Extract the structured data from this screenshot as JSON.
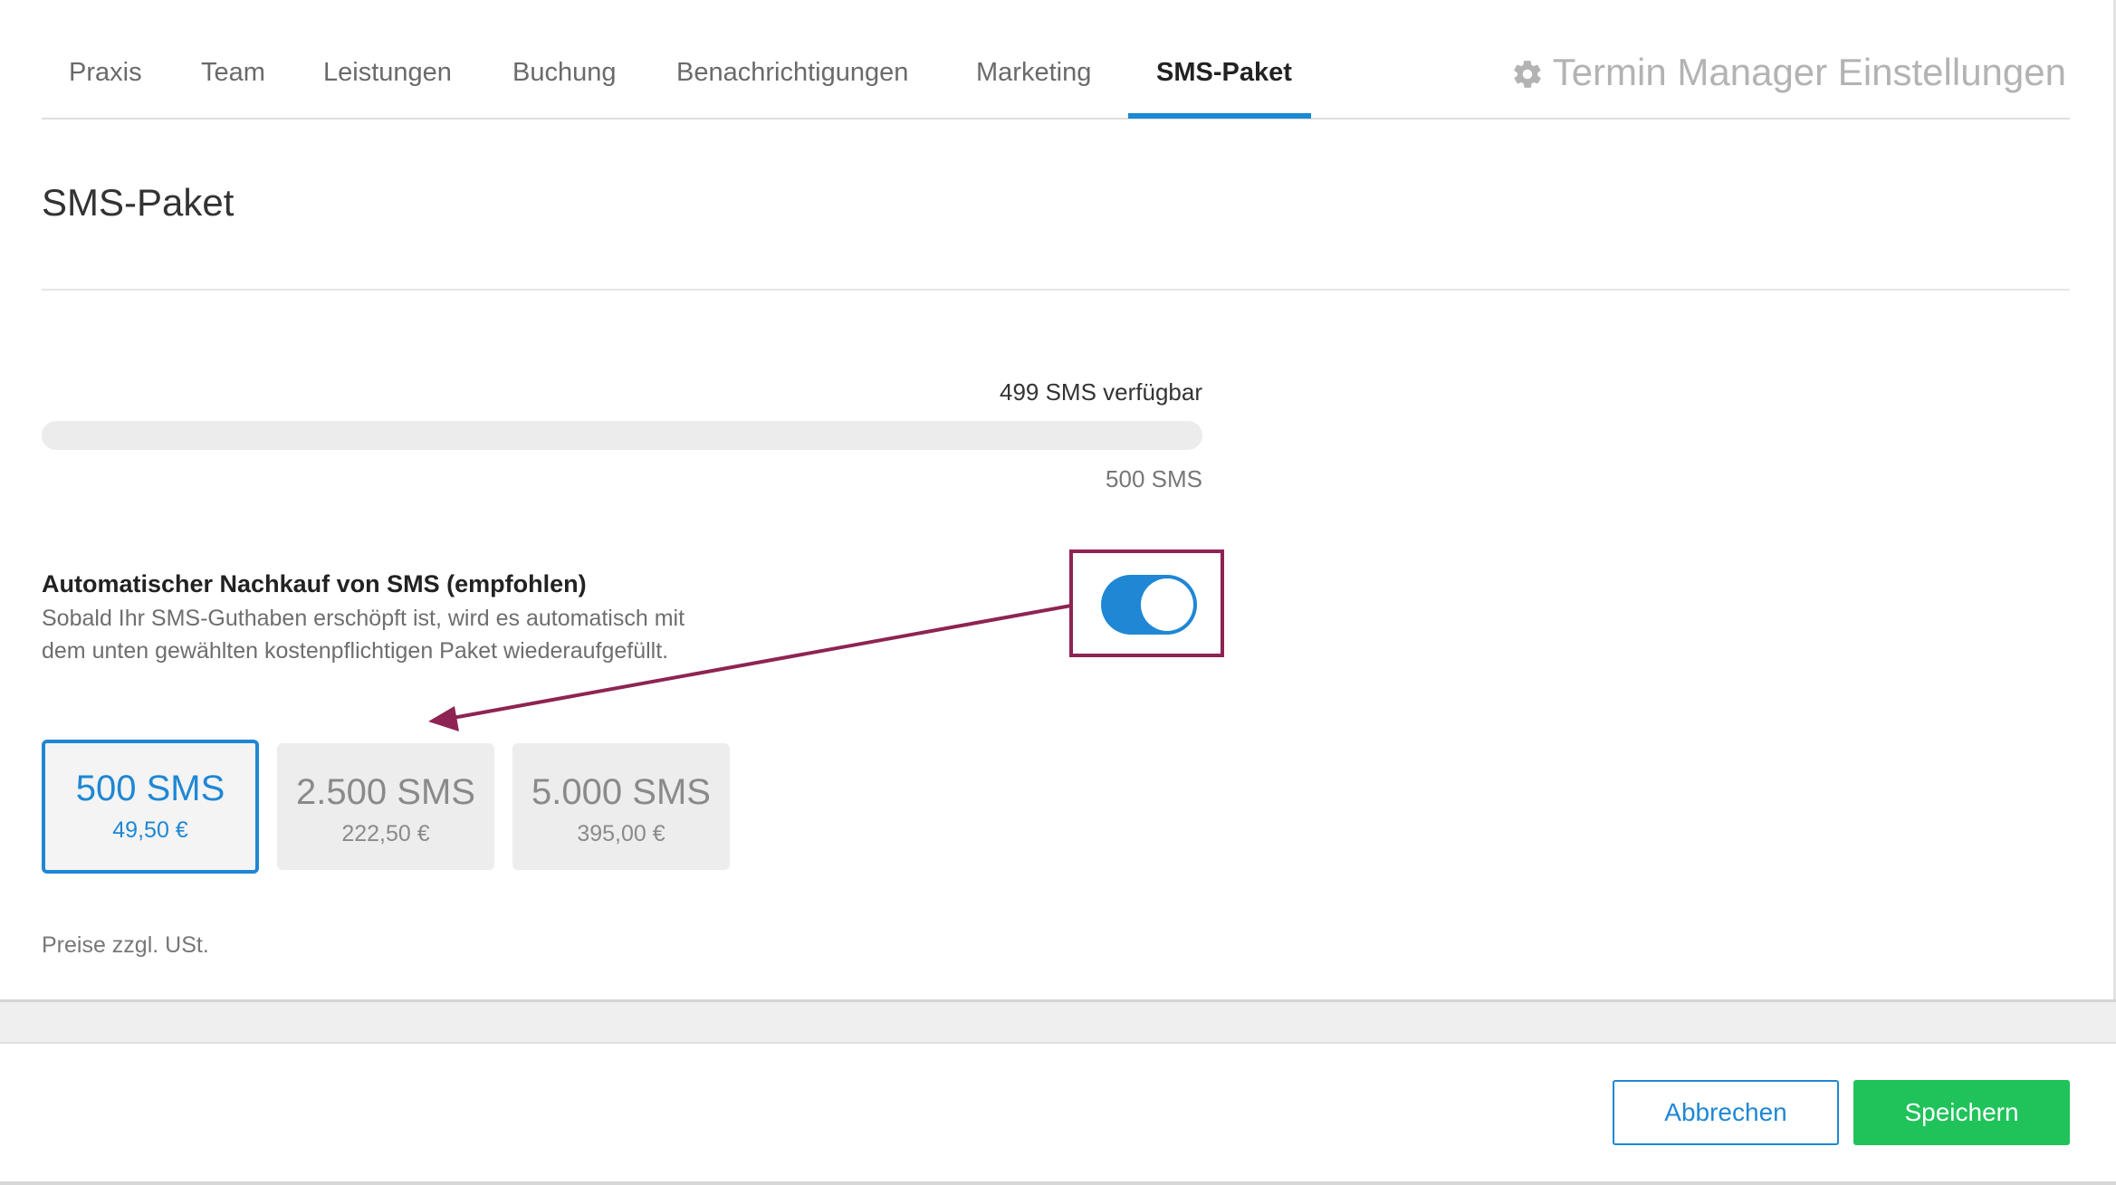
{
  "tabs": [
    {
      "label": "Praxis"
    },
    {
      "label": "Team"
    },
    {
      "label": "Leistungen"
    },
    {
      "label": "Buchung"
    },
    {
      "label": "Benachrichtigungen"
    },
    {
      "label": "Marketing"
    },
    {
      "label": "SMS-Paket",
      "active": true
    }
  ],
  "header": {
    "app_title": "Termin Manager Einstellungen",
    "title_icon": "gear-icon"
  },
  "section": {
    "title": "SMS-Paket"
  },
  "usage": {
    "available_label": "499 SMS verfügbar",
    "total_label": "500 SMS",
    "available_count": 499,
    "total_count": 500
  },
  "auto_purchase": {
    "title": "Automatischer Nachkauf von SMS (empfohlen)",
    "description": "Sobald Ihr SMS-Guthaben erschöpft ist, wird es automatisch mit dem unten gewählten kostenpflichtigen Paket wiederaufgefüllt.",
    "enabled": true
  },
  "packages": [
    {
      "quantity": "500 SMS",
      "price": "49,50 €",
      "selected": true
    },
    {
      "quantity": "2.500 SMS",
      "price": "222,50 €",
      "selected": false
    },
    {
      "quantity": "5.000 SMS",
      "price": "395,00 €",
      "selected": false
    }
  ],
  "vat_note": "Preise zzgl. USt.",
  "footer": {
    "cancel_label": "Abbrechen",
    "save_label": "Speichern"
  },
  "colors": {
    "accent": "#1f87d4",
    "save": "#1fc35a",
    "annotation": "#8e2453"
  }
}
